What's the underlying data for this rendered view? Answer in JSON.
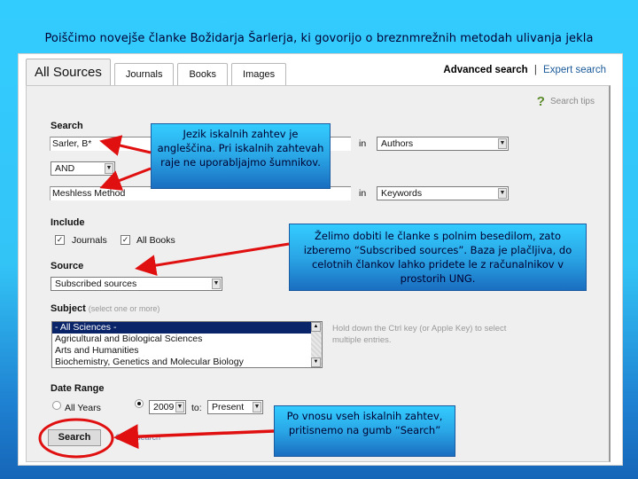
{
  "slide_title": "Poiščimo novejše članke Božidarja Šarlerja, ki govorijo o breznmrežnih metodah ulivanja jekla",
  "tabs": [
    {
      "label": "All Sources",
      "active": true
    },
    {
      "label": "Journals",
      "active": false
    },
    {
      "label": "Books",
      "active": false
    },
    {
      "label": "Images",
      "active": false
    }
  ],
  "top_links": {
    "advanced": "Advanced search",
    "separator": "|",
    "expert": "Expert search"
  },
  "search_tips": {
    "icon": "question-icon",
    "label": "Search tips"
  },
  "search": {
    "label": "Search",
    "term1": {
      "value": "Sarler, B*",
      "in_label": "in",
      "field": "Authors"
    },
    "operator": "AND",
    "term2": {
      "value": "Meshless Method",
      "in_label": "in",
      "field": "Keywords"
    }
  },
  "include": {
    "label": "Include",
    "options": [
      {
        "label": "Journals",
        "checked": true
      },
      {
        "label": "All Books",
        "checked": true
      }
    ]
  },
  "source": {
    "label": "Source",
    "value": "Subscribed sources"
  },
  "subject": {
    "label": "Subject",
    "sublabel": "(select one or more)",
    "options": [
      {
        "label": "- All Sciences -",
        "selected": true
      },
      {
        "label": "Agricultural and Biological Sciences",
        "selected": false
      },
      {
        "label": "Arts and Humanities",
        "selected": false
      },
      {
        "label": "Biochemistry, Genetics and Molecular Biology",
        "selected": false
      }
    ],
    "hint": "Hold down the Ctrl key (or Apple Key) to select multiple entries."
  },
  "date_range": {
    "label": "Date Range",
    "all_years_label": "All Years",
    "all_years_selected": false,
    "from_selected": true,
    "from_year": "2009",
    "to_label": "to:",
    "to_value": "Present"
  },
  "buttons": {
    "search": "Search",
    "clear": "Clear search"
  },
  "callouts": {
    "language": "Jezik iskalnih zahtev je angleščina. Pri iskalnih zahtevah raje ne uporabljajmo šumnikov.",
    "sources": "Želimo dobiti le članke s polnim besedilom, zato izberemo “Subscribed sources”. Baza je plačljiva, do celotnih člankov lahko pridete le z računalnikov v prostorih UNG.",
    "search": "Po vnosu vseh iskalnih zahtev, pritisnemo na gumb “Search”"
  },
  "colors": {
    "slide_bg_top": "#33ccff",
    "slide_bg_bottom": "#1666b8",
    "annotation_red": "#e01010",
    "selected_option": "#0a246a",
    "link_blue": "#1a5a9a"
  }
}
